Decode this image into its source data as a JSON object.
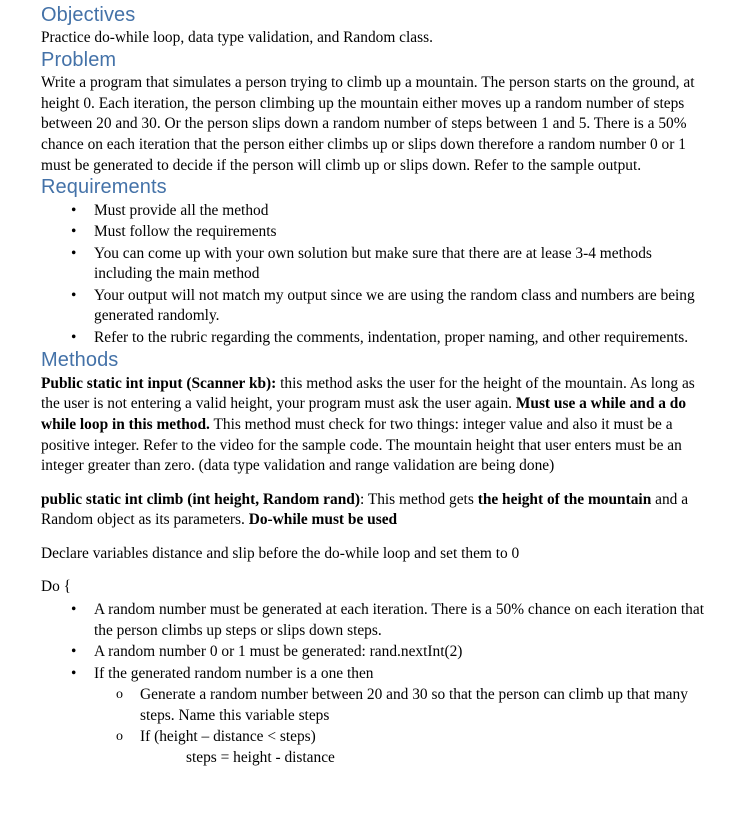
{
  "theme": {
    "heading_color": "#4472A8",
    "body_color": "#000000",
    "page_background": "#ffffff"
  },
  "sections": {
    "objectives": {
      "heading": "Objectives",
      "body": "Practice do-while loop, data type validation, and Random class."
    },
    "problem": {
      "heading": "Problem",
      "body": "Write a program that simulates a person trying to climb up a mountain. The person starts on the ground, at height 0. Each iteration, the person climbing up the mountain either moves up a random number of steps between 20 and 30. Or the person slips down a random number of steps between 1 and 5.    There is a 50% chance on each iteration that the person either climbs up or slips down therefore a random number 0 or 1 must be generated to decide if the person will climb up or slips down.   Refer to the sample output."
    },
    "requirements": {
      "heading": "Requirements",
      "bullet_marker": "•",
      "items": [
        "Must provide all the method",
        "Must follow the requirements",
        "You can come up with your own solution but make sure that there are at lease 3-4 methods including the main method",
        "Your output will not match my output since we are using the random class and numbers are being generated randomly.",
        "Refer to the rubric regarding the comments, indentation, proper naming, and other requirements."
      ]
    },
    "methods": {
      "heading": "Methods",
      "input_method": {
        "bold_1": "Public static int input (Scanner kb):",
        "text_1": " this method asks the user for the height of the mountain. As long as the user is not entering a valid height, your program must ask the user again. ",
        "bold_2": "Must use a while and a do while loop in this method.",
        "text_2": " This method must check for two things: integer value and also it must be a positive integer. Refer to the video for the sample code. The mountain height that user enters must be an integer greater than zero.  (data type validation and range validation are being done)"
      },
      "climb_method": {
        "bold_1": "public static int climb (int height, Random rand)",
        "text_1": ":  This method gets ",
        "bold_2": "the height of the mountain",
        "text_2": " and a Random object as its parameters.   ",
        "bold_3": "Do-while must be used"
      },
      "declare_line": "Declare variables distance and slip before the do-while loop and set them to 0",
      "do_line": "Do {",
      "bullet_marker": "•",
      "sub_bullet_marker": "o",
      "do_items": [
        "A random number must be generated at each iteration. There is a 50% chance on each iteration that the person climbs up steps or slips down steps.",
        "A random number 0 or 1 must be generated: rand.nextInt(2)",
        "If the generated random number is a one then"
      ],
      "sub_items": [
        {
          "text": " Generate a random number between 20 and 30 so that the person can climb up that many steps.  Name this variable steps",
          "continuation": ""
        },
        {
          "text": "If (height – distance  < steps)",
          "continuation": "steps = height - distance"
        }
      ]
    }
  }
}
